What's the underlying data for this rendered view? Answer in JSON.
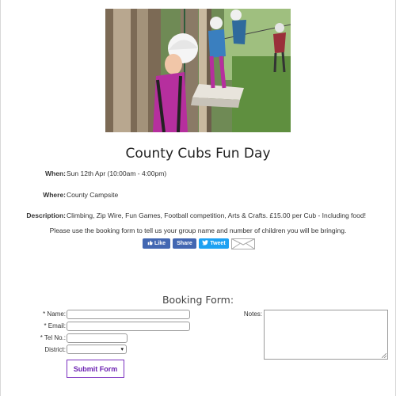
{
  "event": {
    "title": "County Cubs Fun Day",
    "when_label": "When:",
    "when_value": "Sun 12th Apr (10:00am - 4:00pm)",
    "where_label": "Where:",
    "where_value": "County Campsite",
    "description_label": "Description:",
    "description_value": "Climbing, Zip Wire, Fun Games, Football competition, Arts & Crafts. £15.00 per Cub - Including food!",
    "booking_note": "Please use the booking form to tell us your group name and number of children you will be bringing."
  },
  "social": {
    "like_label": "Like",
    "share_label": "Share",
    "tweet_label": "Tweet",
    "like_color": "#4267b2",
    "tweet_color": "#1da1f2",
    "email_icon": "envelope-icon"
  },
  "form": {
    "title": "Booking Form:",
    "name_label": "* Name:",
    "email_label": "* Email:",
    "tel_label": "* Tel No.:",
    "district_label": "District:",
    "district_selected": "",
    "notes_label": "Notes:",
    "submit_label": "Submit Form",
    "submit_color": "#6a1fb0"
  }
}
